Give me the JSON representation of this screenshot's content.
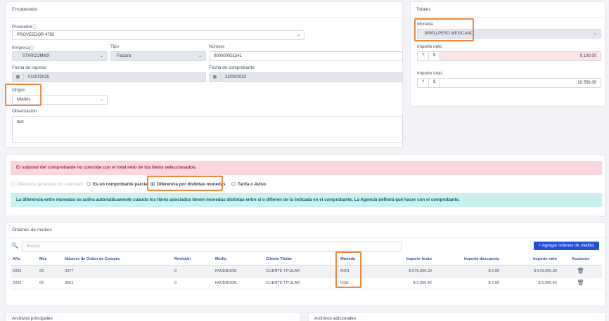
{
  "encabezado": {
    "title": "Encabezado",
    "proveedor": {
      "label": "Proveedorⓘ",
      "value": "PROVEEDOR 4785"
    },
    "empresa": {
      "label": "Empresaⓘ",
      "value": "STARCOMMX"
    },
    "tipo": {
      "label": "Tipo",
      "value": "Factura"
    },
    "numero": {
      "label": "Número",
      "value": "000000051541"
    },
    "fecha_ingreso": {
      "label": "Fecha de ingreso",
      "value": "01/10/2025"
    },
    "fecha_comprobante": {
      "label": "Fecha de comprobante",
      "value": "22/08/2023"
    },
    "origen": {
      "label": "Origen",
      "value": "Medios"
    },
    "observacion": {
      "label": "Observación",
      "value": "test"
    }
  },
  "totales": {
    "title": "Totales",
    "moneda": {
      "label": "Moneda",
      "value": "(MXN) PESO MEXICANO"
    },
    "importe_neto": {
      "label": "Importe neto",
      "value": "9,100.00"
    },
    "importe_total": {
      "label": "Importe total",
      "value": "10,556.00"
    },
    "help_symbol": "?",
    "currency_symbol": "$"
  },
  "alerts": {
    "subtotal_error": "El subtotal del comprobante no coincide con el total neto de los items seleccionados.",
    "info": "La diferencia entre monedas se activa automáticamente cuando los items asociados tienen monedas distintas entre sí o difieren de la indicada en el comprobante. La Agencia definirá qué hacer con el comprobante."
  },
  "options": {
    "redondeo": "Diferencia generada por redondeo",
    "parcial": "Es un comprobante parcial",
    "monedas": "Diferencia por distintas monedas",
    "tarifa": "Tarifa o Aviso"
  },
  "ordenes": {
    "title": "Órdenes de medios",
    "search_placeholder": "Buscar",
    "add_button": "Agregar órdenes de medios",
    "columns": [
      "Año",
      "Mes",
      "Número de Orden de Compra",
      "Revisión",
      "Medio",
      "Cliente Titular",
      "Moneda",
      "Importe bruto",
      "Importe descuento",
      "Importe neto",
      "Acciones"
    ],
    "rows": [
      {
        "anio": "2025",
        "mes": "06",
        "numero": "3377",
        "revision": "0",
        "medio": "FACEBOOK",
        "cliente": "CLIENTE TITULAR",
        "moneda": "MXN",
        "bruto": "$ 579,996.39",
        "descuento": "$ 0.00",
        "neto": "$ 579,996.39"
      },
      {
        "anio": "2025",
        "mes": "06",
        "numero": "3551",
        "revision": "0",
        "medio": "FACEBOOK",
        "cliente": "CLIENTE TITULAR",
        "moneda": "USD",
        "bruto": "$ 5,066.42",
        "descuento": "$ 0.00",
        "neto": "$ 5,066.42"
      }
    ]
  },
  "footer": {
    "archivos_principales": "Archivos principales",
    "archivos_adicionales": "Archivos adicionales"
  },
  "colors": {
    "accent": "#1e4fd6",
    "highlight": "#f0883e",
    "error_bg": "#fbd6de",
    "info_bg": "#c8f1ef"
  }
}
